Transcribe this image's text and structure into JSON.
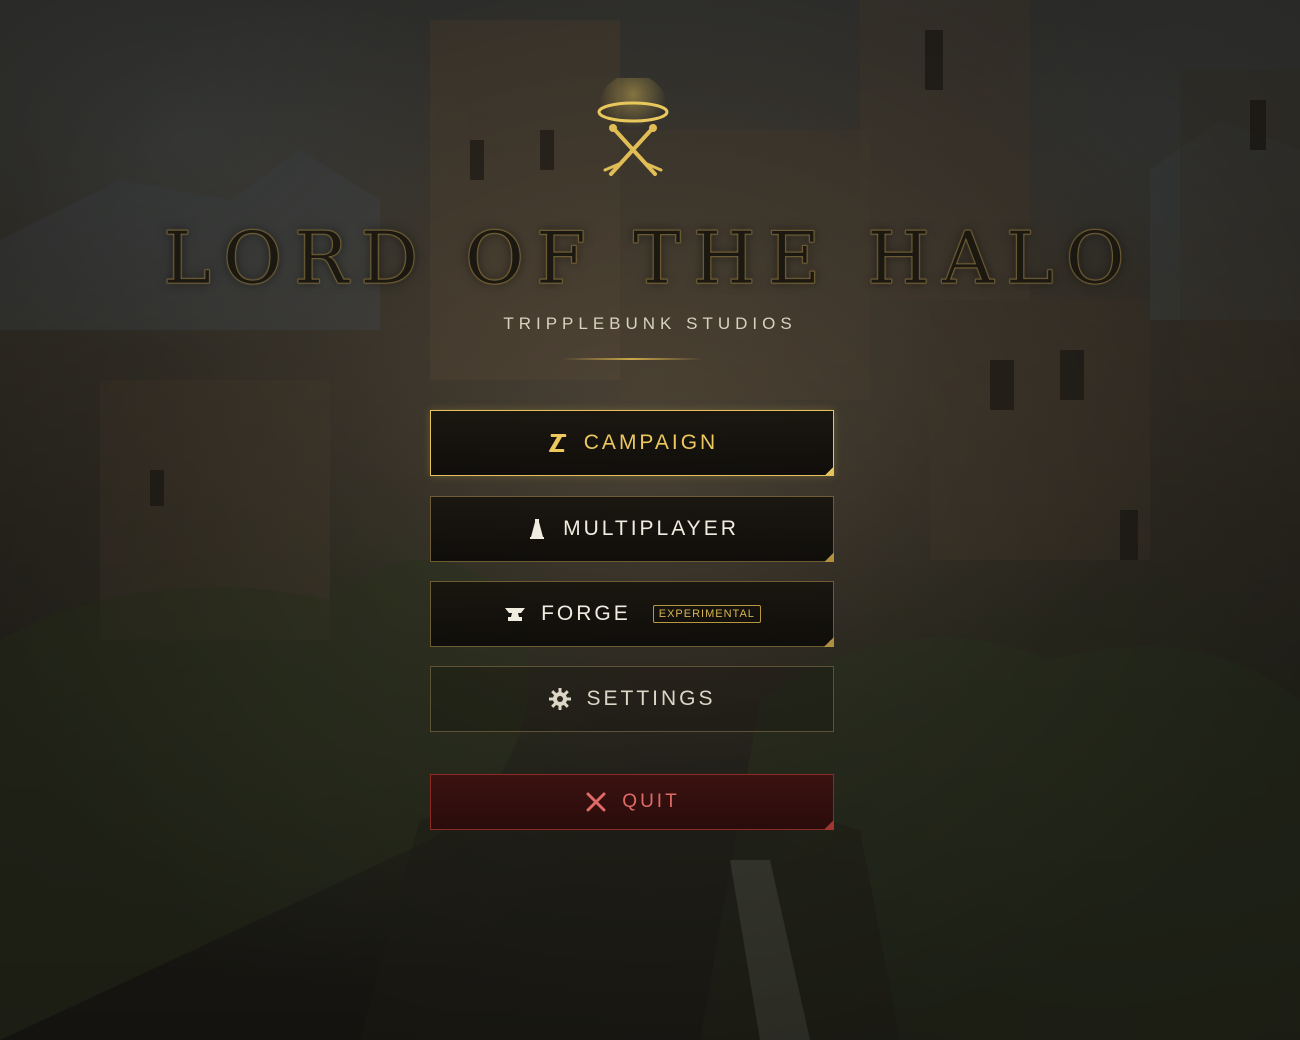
{
  "game": {
    "title": "LORD OF THE HALO",
    "studio": "TRIPPLEBUNK STUDIOS"
  },
  "menu": {
    "campaign": {
      "label": "CAMPAIGN",
      "icon": "scroll-icon"
    },
    "multiplayer": {
      "label": "MULTIPLAYER",
      "icon": "pawn-icon"
    },
    "forge": {
      "label": "FORGE",
      "icon": "anvil-icon",
      "badge": "EXPERIMENTAL"
    },
    "settings": {
      "label": "SETTINGS",
      "icon": "gear-icon"
    },
    "quit": {
      "label": "QUIT",
      "icon": "crossed-swords-icon"
    }
  },
  "colors": {
    "gold": "#e5c35a",
    "quit_red": "#e06a66",
    "button_bg": "#14110c"
  }
}
